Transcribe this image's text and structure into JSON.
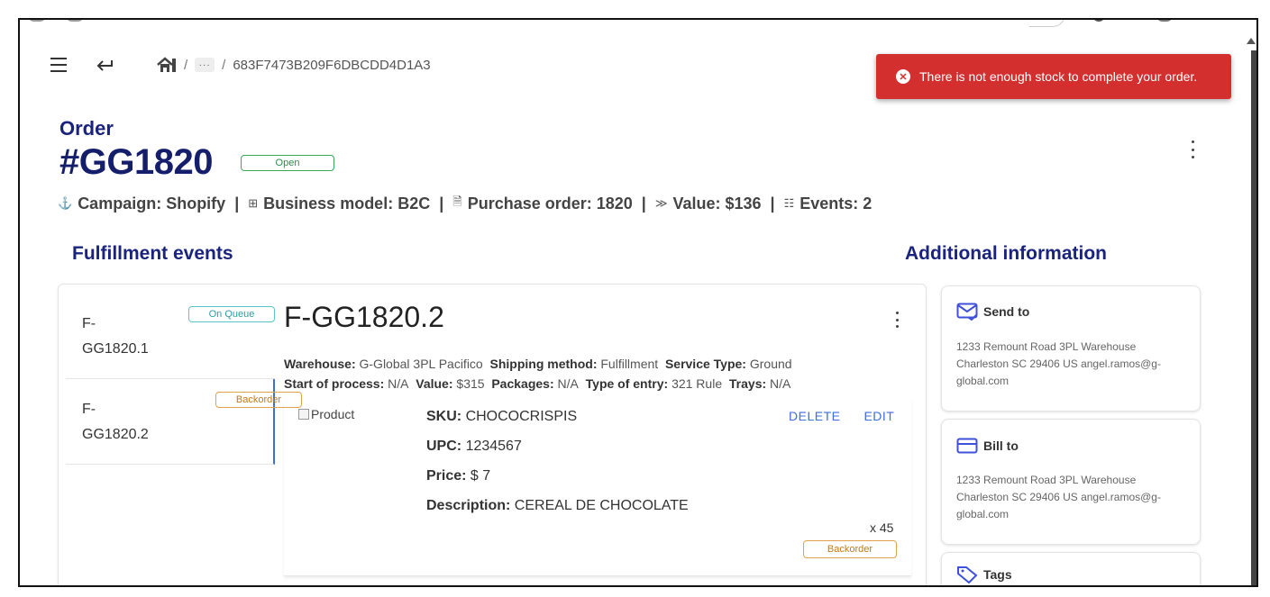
{
  "breadcrumb": {
    "ellipsis": "···",
    "current": "683F7473B209F6DBCDD4D1A3",
    "sep1": "/",
    "sep2": "/"
  },
  "toast": {
    "message": "There is not enough stock to complete your order."
  },
  "order": {
    "label": "Order",
    "number": "#GG1820",
    "status": "Open"
  },
  "meta": {
    "campaign": "Campaign: Shopify",
    "business_model": "Business model: B2C",
    "purchase_order": "Purchase order: 1820",
    "value": "Value: $136",
    "events": "Events: 2",
    "pipe": "|"
  },
  "sections": {
    "fulfillment": "Fulfillment events",
    "additional": "Additional information"
  },
  "events": [
    {
      "name_line1": "F-",
      "name_line2": "GG1820.1",
      "status": "On Queue"
    },
    {
      "name_line1": "F-",
      "name_line2": "GG1820.2",
      "status": "Backorder"
    }
  ],
  "detail": {
    "title": "F-GG1820.2",
    "warehouse_label": "Warehouse:",
    "warehouse": "G-Global 3PL Pacifico",
    "shipping_label": "Shipping method:",
    "shipping": "Fulfillment",
    "service_label": "Service Type:",
    "service": "Ground",
    "start_label": "Start of process:",
    "start": "N/A",
    "value_label": "Value:",
    "value": "$315",
    "packages_label": "Packages:",
    "packages": "N/A",
    "entry_label": "Type of entry:",
    "entry": "321 Rule",
    "trays_label": "Trays:",
    "trays": "N/A"
  },
  "product": {
    "img_alt": "Product",
    "sku_label": "SKU:",
    "sku": "CHOCOCRISPIS",
    "upc_label": "UPC:",
    "upc": "1234567",
    "price_label": "Price:",
    "price": "$ 7",
    "desc_label": "Description:",
    "desc": "CEREAL DE CHOCOLATE",
    "delete": "DELETE",
    "edit": "EDIT",
    "qty": "x 45",
    "status": "Backorder"
  },
  "info": {
    "send_to": {
      "title": "Send to",
      "address": "1233 Remount Road 3PL Warehouse Charleston SC 29406 US angel.ramos@g-global.com"
    },
    "bill_to": {
      "title": "Bill to",
      "address": "1233 Remount Road 3PL Warehouse Charleston SC 29406 US angel.ramos@g-global.com"
    },
    "tags": {
      "title": "Tags"
    }
  },
  "colors": {
    "navy": "#1a237e",
    "error": "#d32f2f",
    "link": "#3f6fd8",
    "open": "#3aa75c",
    "backorder": "#e0a24a",
    "queue": "#5cc5c7"
  }
}
